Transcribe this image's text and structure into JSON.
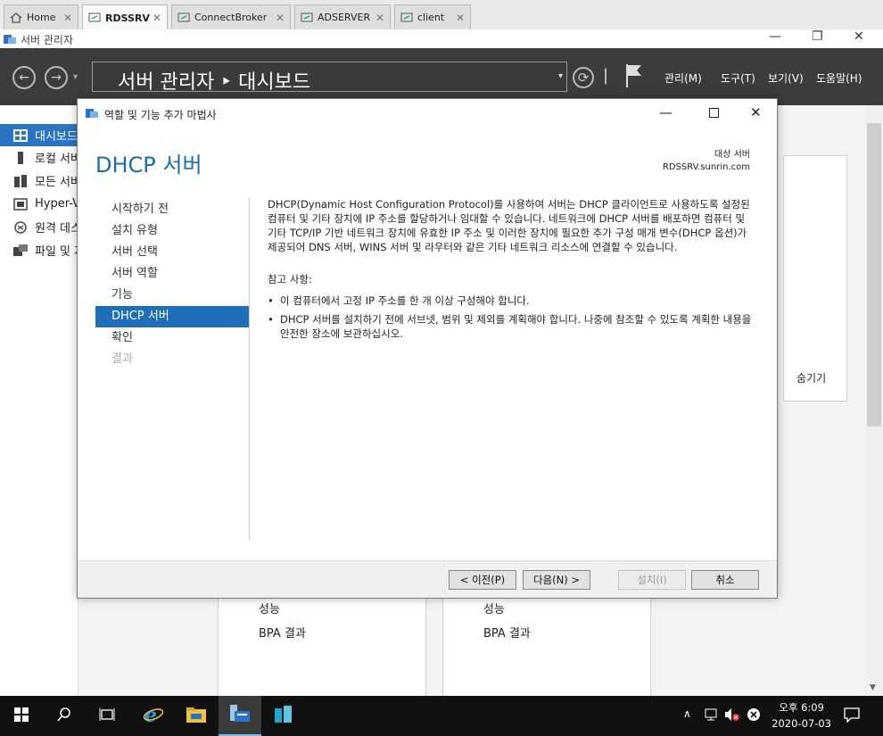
{
  "vm_tabs": [
    {
      "label": "Home",
      "icon": "home-icon"
    },
    {
      "label": "RDSSRV",
      "icon": "vm-icon"
    },
    {
      "label": "ConnectBroker",
      "icon": "vm-icon"
    },
    {
      "label": "ADSERVER",
      "icon": "vm-icon"
    },
    {
      "label": "client",
      "icon": "vm-icon"
    }
  ],
  "vm_tab_close": "✕",
  "app": {
    "title": "서버 관리자",
    "minimize": "—",
    "restore": "❐",
    "close": "✕"
  },
  "header": {
    "breadcrumb": "서버 관리자 ‣ 대시보드",
    "back": "←",
    "forward": "→",
    "refresh": "⟳",
    "menu": [
      "관리(M)",
      "도구(T)",
      "보기(V)",
      "도움말(H)"
    ]
  },
  "leftnav": [
    {
      "label": "대시보드",
      "icon": "dashboard-icon"
    },
    {
      "label": "로컬 서버",
      "icon": "local-server-icon"
    },
    {
      "label": "모든 서버",
      "icon": "all-servers-icon"
    },
    {
      "label": "Hyper-V",
      "icon": "hyperv-icon"
    },
    {
      "label": "원격 데스크톱 서비스",
      "icon": "remote-desktop-icon"
    },
    {
      "label": "파일 및 저장소 서비스",
      "icon": "file-storage-icon"
    }
  ],
  "dashboard": {
    "hide_label": "숨기기",
    "tiles": [
      {
        "perf": "성능",
        "bpa": "BPA 결과"
      },
      {
        "perf": "성능",
        "bpa": "BPA 결과"
      }
    ]
  },
  "wizard": {
    "title": "역할 및 기능 추가 마법사",
    "heading": "DHCP 서버",
    "target_label": "대상 서버",
    "target_server": "RDSSRV.sunrin.com",
    "steps": [
      {
        "label": "시작하기 전",
        "state": "normal"
      },
      {
        "label": "설치 유형",
        "state": "normal"
      },
      {
        "label": "서버 선택",
        "state": "normal"
      },
      {
        "label": "서버 역할",
        "state": "normal"
      },
      {
        "label": "기능",
        "state": "normal"
      },
      {
        "label": "DHCP 서버",
        "state": "current"
      },
      {
        "label": "확인",
        "state": "normal"
      },
      {
        "label": "결과",
        "state": "disabled"
      }
    ],
    "description": "DHCP(Dynamic Host Configuration Protocol)를 사용하여 서버는 DHCP 클라이언트로 사용하도록 설정된 컴퓨터 및 기타 장치에 IP 주소를 할당하거나 임대할 수 있습니다. 네트워크에 DHCP 서버를 배포하면 컴퓨터 및 기타 TCP/IP 기반 네트워크 장치에 유효한 IP 주소 및 이러한 장치에 필요한 추가 구성 매개 변수(DHCP 옵션)가 제공되어 DNS 서버, WINS 서버 및 라우터와 같은 기타 네트워크 리소스에 연결할 수 있습니다.",
    "notes_title": "참고 사항:",
    "notes": [
      "이 컴퓨터에서 고정 IP 주소를 한 개 이상 구성해야 합니다.",
      "DHCP 서버를 설치하기 전에 서브넷, 범위 및 제외를 계획해야 합니다. 나중에 참조할 수 있도록 계획한 내용을 안전한 장소에 보관하십시오."
    ],
    "buttons": {
      "prev": "< 이전(P)",
      "next": "다음(N) >",
      "install": "설치(I)",
      "cancel": "취소"
    }
  },
  "taskbar": {
    "time": "오후 6:09",
    "date": "2020-07-03"
  }
}
